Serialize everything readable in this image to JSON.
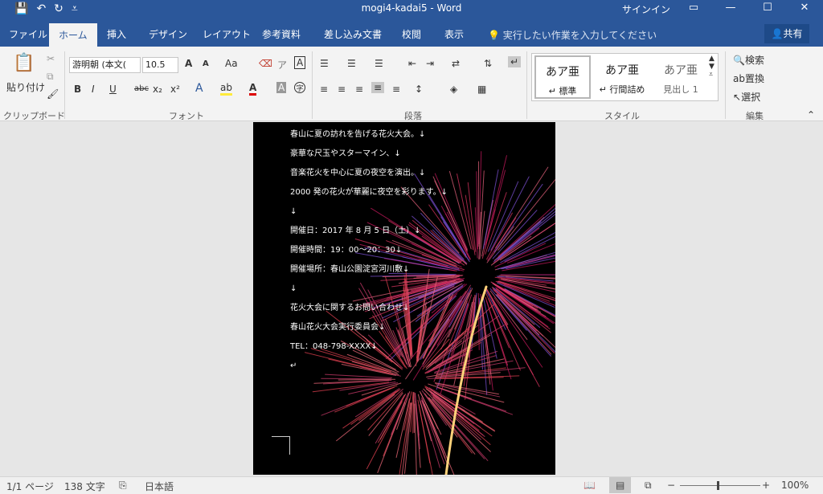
{
  "window": {
    "title": "mogi4-kadai5  -  Word",
    "signin": "サインイン"
  },
  "qat": {
    "save_icon": "save-icon",
    "undo_icon": "undo-icon",
    "redo_icon": "redo-icon",
    "customize_icon": "customize-icon"
  },
  "tabs": {
    "file": "ファイル",
    "home": "ホーム",
    "insert": "挿入",
    "design": "デザイン",
    "layout": "レイアウト",
    "references": "参考資料",
    "mailings": "差し込み文書",
    "review": "校閲",
    "view": "表示"
  },
  "tellme": "実行したい作業を入力してください",
  "share": "共有",
  "clipboard": {
    "paste": "貼り付け",
    "label": "クリップボード"
  },
  "font": {
    "name": "游明朝 (本文(",
    "size": "10.5",
    "label": "フォント",
    "bold": "B",
    "italic": "I",
    "underline": "U",
    "strike": "abc",
    "sub": "x₂",
    "sup": "x²",
    "grow": "A",
    "shrink": "A",
    "case": "Aa",
    "clear": "A"
  },
  "paragraph": {
    "label": "段落"
  },
  "styles": {
    "label": "スタイル",
    "items": [
      {
        "sample": "あア亜",
        "name": "↵ 標準"
      },
      {
        "sample": "あア亜",
        "name": "↵ 行間詰め"
      },
      {
        "sample": "あア亜",
        "name": "見出し 1"
      }
    ]
  },
  "editing": {
    "find": "検索",
    "replace": "置換",
    "select": "選択",
    "label": "編集"
  },
  "document": {
    "lines": [
      "春山に夏の訪れを告げる花火大会。↓",
      "豪華な尺玉やスターマイン、↓",
      "音楽花火を中心に夏の夜空を演出。↓",
      "2000 発の花火が華麗に夜空を彩ります。↓",
      "↓",
      "開催日：2017 年 8 月 5 日（土）↓",
      "開催時間：19：00〜20：30↓",
      "開催場所：春山公園淀宮河川敷↓",
      "↓",
      "花火大会に関するお問い合わせ↓",
      "春山花火大会実行委員会↓",
      "TEL：048-798-XXXX↓",
      "↵"
    ]
  },
  "status": {
    "page": "1/1 ページ",
    "words": "138 文字",
    "lang": "日本語",
    "zoom": "100%"
  }
}
